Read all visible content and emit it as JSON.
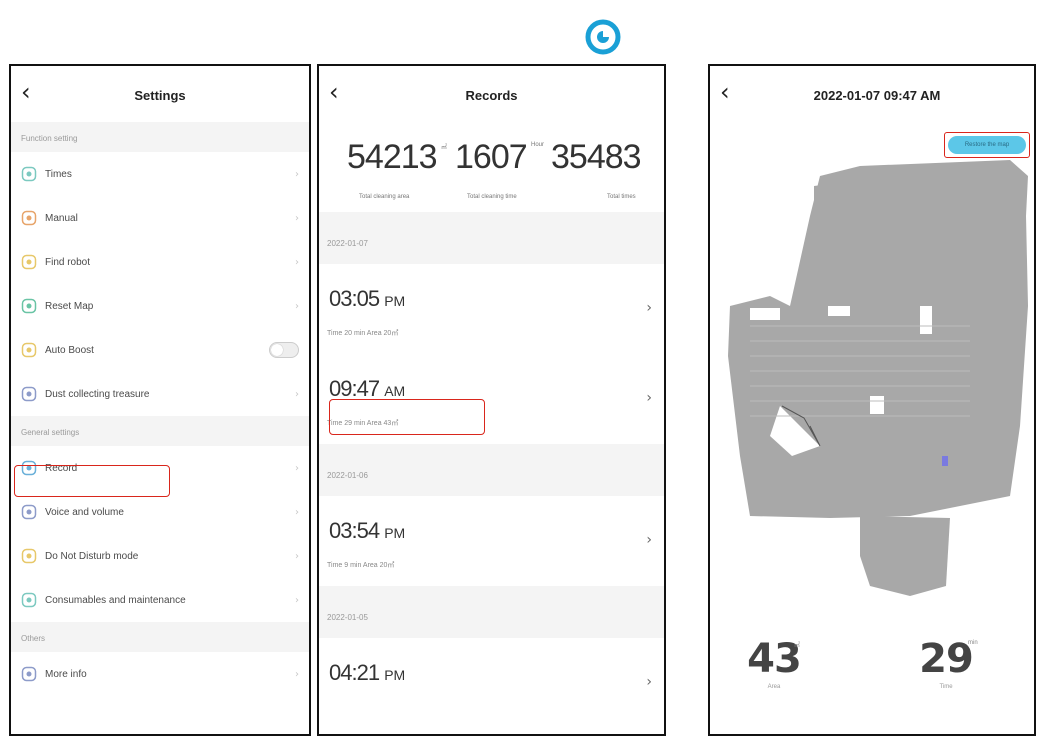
{
  "logo": {
    "icon": "app-logo-icon",
    "color": "#1aa0d6"
  },
  "settings": {
    "title": "Settings",
    "back_glyph": "‹",
    "section_function": "Function setting",
    "items_function": [
      {
        "label": "Times",
        "icon": "clock-icon",
        "color": "#7cc9c0"
      },
      {
        "label": "Manual",
        "icon": "remote-control-icon",
        "color": "#e7a46a"
      },
      {
        "label": "Find robot",
        "icon": "locate-icon",
        "color": "#e7c86a"
      },
      {
        "label": "Reset Map",
        "icon": "refresh-icon",
        "color": "#6ac4a5"
      },
      {
        "label": "Auto Boost",
        "icon": "boost-icon",
        "color": "#e7c86a"
      },
      {
        "label": "Dust collecting treasure",
        "icon": "dustbin-icon",
        "color": "#8d9bc9"
      }
    ],
    "section_general": "General settings",
    "items_general": [
      {
        "label": "Record",
        "icon": "record-icon",
        "color": "#6ab0d9"
      },
      {
        "label": "Voice and volume",
        "icon": "bell-icon",
        "color": "#8d9bc9"
      },
      {
        "label": "Do Not Disturb mode",
        "icon": "moon-icon",
        "color": "#e7c86a"
      },
      {
        "label": "Consumables and maintenance",
        "icon": "tool-icon",
        "color": "#7cc9c0"
      }
    ],
    "section_others": "Others",
    "items_others": [
      {
        "label": "More info",
        "icon": "info-icon",
        "color": "#8d9bc9"
      }
    ],
    "chevron": "›"
  },
  "records": {
    "title": "Records",
    "back_glyph": "‹",
    "stats": [
      {
        "value": "54213",
        "unit": "㎡",
        "label": "Total cleaning area"
      },
      {
        "value": "1607",
        "unit": "Hour",
        "label": "Total cleaning time"
      },
      {
        "value": "35483",
        "unit": "",
        "label": "Total times"
      }
    ],
    "groups": [
      {
        "date": "2022-01-07",
        "items": [
          {
            "time": "03:05",
            "ampm": "PM",
            "sub": "Time 20 min   Area 20㎡"
          },
          {
            "time": "09:47",
            "ampm": "AM",
            "sub": "Time 29 min   Area 43㎡"
          }
        ]
      },
      {
        "date": "2022-01-06",
        "items": [
          {
            "time": "03:54",
            "ampm": "PM",
            "sub": "Time 9 min   Area 20㎡"
          }
        ]
      },
      {
        "date": "2022-01-05",
        "items": [
          {
            "time": "04:21",
            "ampm": "PM",
            "sub": ""
          }
        ]
      }
    ],
    "chevron": "›"
  },
  "detail": {
    "title": "2022-01-07 09:47 AM",
    "back_glyph": "‹",
    "button_label": "Restore the map",
    "metrics": [
      {
        "value": "43",
        "unit": "㎡",
        "label": "Area"
      },
      {
        "value": "29",
        "unit": "min",
        "label": "Time"
      }
    ],
    "map_color": "#a8a8a8",
    "highlight_color": "#d9261c"
  }
}
